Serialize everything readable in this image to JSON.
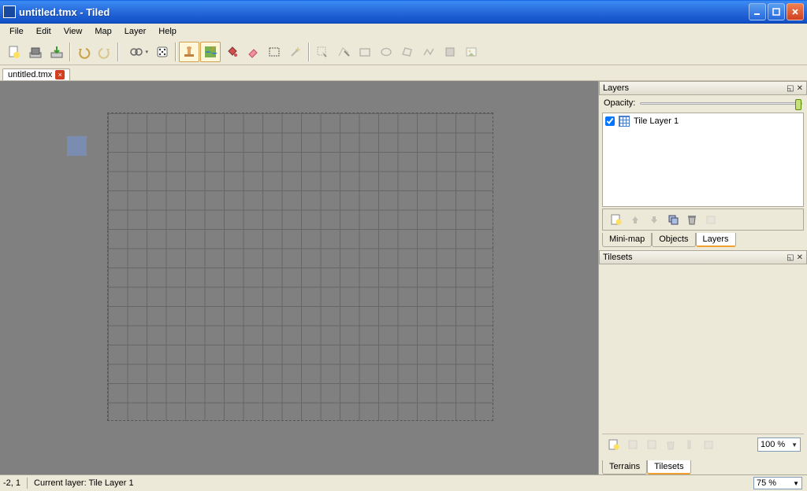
{
  "title": "untitled.tmx - Tiled",
  "menu": [
    "File",
    "Edit",
    "View",
    "Map",
    "Layer",
    "Help"
  ],
  "doc_tab": "untitled.tmx",
  "layers_panel": {
    "title": "Layers",
    "opacity_label": "Opacity:",
    "layer_name": "Tile Layer 1",
    "tabs": [
      "Mini-map",
      "Objects",
      "Layers"
    ]
  },
  "tilesets_panel": {
    "title": "Tilesets",
    "zoom": "100 %",
    "tabs": [
      "Terrains",
      "Tilesets"
    ]
  },
  "status": {
    "coords": "-2, 1",
    "layer": "Current layer: Tile Layer 1",
    "zoom": "75 %"
  },
  "icons": {
    "new": "new-file-icon",
    "open": "open-icon",
    "save": "save-icon",
    "undo": "undo-icon",
    "redo": "redo-icon",
    "command": "command-icon",
    "random": "random-icon",
    "stamp": "stamp-icon",
    "terrain": "terrain-icon",
    "fill": "fill-icon",
    "eraser": "eraser-icon",
    "rect-select": "rect-select-icon",
    "wand": "wand-icon",
    "object-select": "object-select-icon",
    "edit-poly": "edit-poly-icon",
    "insert-rect": "insert-rect-icon",
    "insert-ellipse": "insert-ellipse-icon",
    "insert-polygon": "insert-polygon-icon",
    "insert-polyline": "insert-polyline-icon",
    "insert-tile": "insert-tile-icon",
    "insert-image": "insert-image-icon"
  }
}
